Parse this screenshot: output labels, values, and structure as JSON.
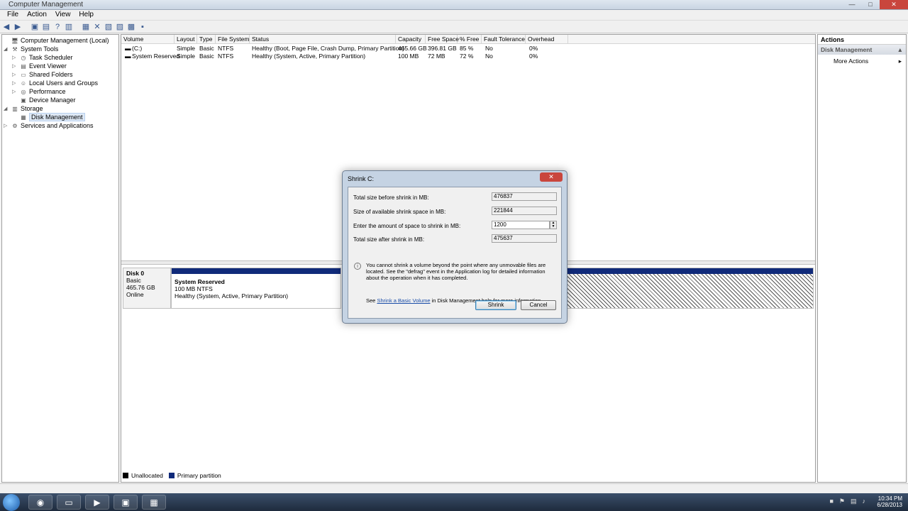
{
  "window": {
    "title": "Computer Management"
  },
  "menu": [
    "File",
    "Action",
    "View",
    "Help"
  ],
  "tree": [
    {
      "label": "Computer Management (Local)",
      "icon": "computer-icon",
      "depth": 0,
      "expander": ""
    },
    {
      "label": "System Tools",
      "icon": "tools-icon",
      "depth": 1,
      "expander": "◢"
    },
    {
      "label": "Task Scheduler",
      "icon": "clock-icon",
      "depth": 2,
      "expander": "▷"
    },
    {
      "label": "Event Viewer",
      "icon": "event-icon",
      "depth": 2,
      "expander": "▷"
    },
    {
      "label": "Shared Folders",
      "icon": "folder-icon",
      "depth": 2,
      "expander": "▷"
    },
    {
      "label": "Local Users and Groups",
      "icon": "users-icon",
      "depth": 2,
      "expander": "▷"
    },
    {
      "label": "Performance",
      "icon": "performance-icon",
      "depth": 2,
      "expander": "▷"
    },
    {
      "label": "Device Manager",
      "icon": "device-icon",
      "depth": 2,
      "expander": ""
    },
    {
      "label": "Storage",
      "icon": "storage-icon",
      "depth": 1,
      "expander": "◢"
    },
    {
      "label": "Disk Management",
      "icon": "disk-icon",
      "depth": 2,
      "expander": "",
      "selected": true
    },
    {
      "label": "Services and Applications",
      "icon": "services-icon",
      "depth": 1,
      "expander": "▷"
    }
  ],
  "volumes": {
    "headers": [
      "Volume",
      "Layout",
      "Type",
      "File System",
      "Status",
      "Capacity",
      "Free Space",
      "% Free",
      "Fault Tolerance",
      "Overhead"
    ],
    "rows": [
      [
        "(C:)",
        "Simple",
        "Basic",
        "NTFS",
        "Healthy (Boot, Page File, Crash Dump, Primary Partition)",
        "465.66 GB",
        "396.81 GB",
        "85 %",
        "No",
        "0%"
      ],
      [
        "System Reserved",
        "Simple",
        "Basic",
        "NTFS",
        "Healthy (System, Active, Primary Partition)",
        "100 MB",
        "72 MB",
        "72 %",
        "No",
        "0%"
      ]
    ]
  },
  "disk": {
    "name": "Disk 0",
    "type": "Basic",
    "size": "465.76 GB",
    "status": "Online",
    "partition": {
      "title": "System Reserved",
      "size": "100 MB NTFS",
      "status": "Healthy (System, Active, Primary Partition)"
    }
  },
  "legend": {
    "unallocated": "Unallocated",
    "primary": "Primary partition",
    "unallocated_color": "#000000",
    "primary_color": "#102a7a"
  },
  "actions": {
    "header": "Actions",
    "section": "Disk Management",
    "more": "More Actions"
  },
  "dialog": {
    "title": "Shrink C:",
    "total_before_label": "Total size before shrink in MB:",
    "total_before": "476837",
    "available_label": "Size of available shrink space in MB:",
    "available": "221844",
    "amount_label": "Enter the amount of space to shrink in MB:",
    "amount": "1200",
    "total_after_label": "Total size after shrink in MB:",
    "total_after": "475637",
    "warning": "You cannot shrink a volume beyond the point where any unmovable files are located. See the \"defrag\" event in the Application log for detailed information about the operation when it has completed.",
    "see_prefix": "See",
    "see_link": "Shrink a Basic Volume",
    "see_suffix": "in Disk Management help for more information.",
    "shrink_button": "Shrink",
    "cancel_button": "Cancel"
  },
  "clock": {
    "time": "10:34 PM",
    "date": "6/28/2013"
  }
}
